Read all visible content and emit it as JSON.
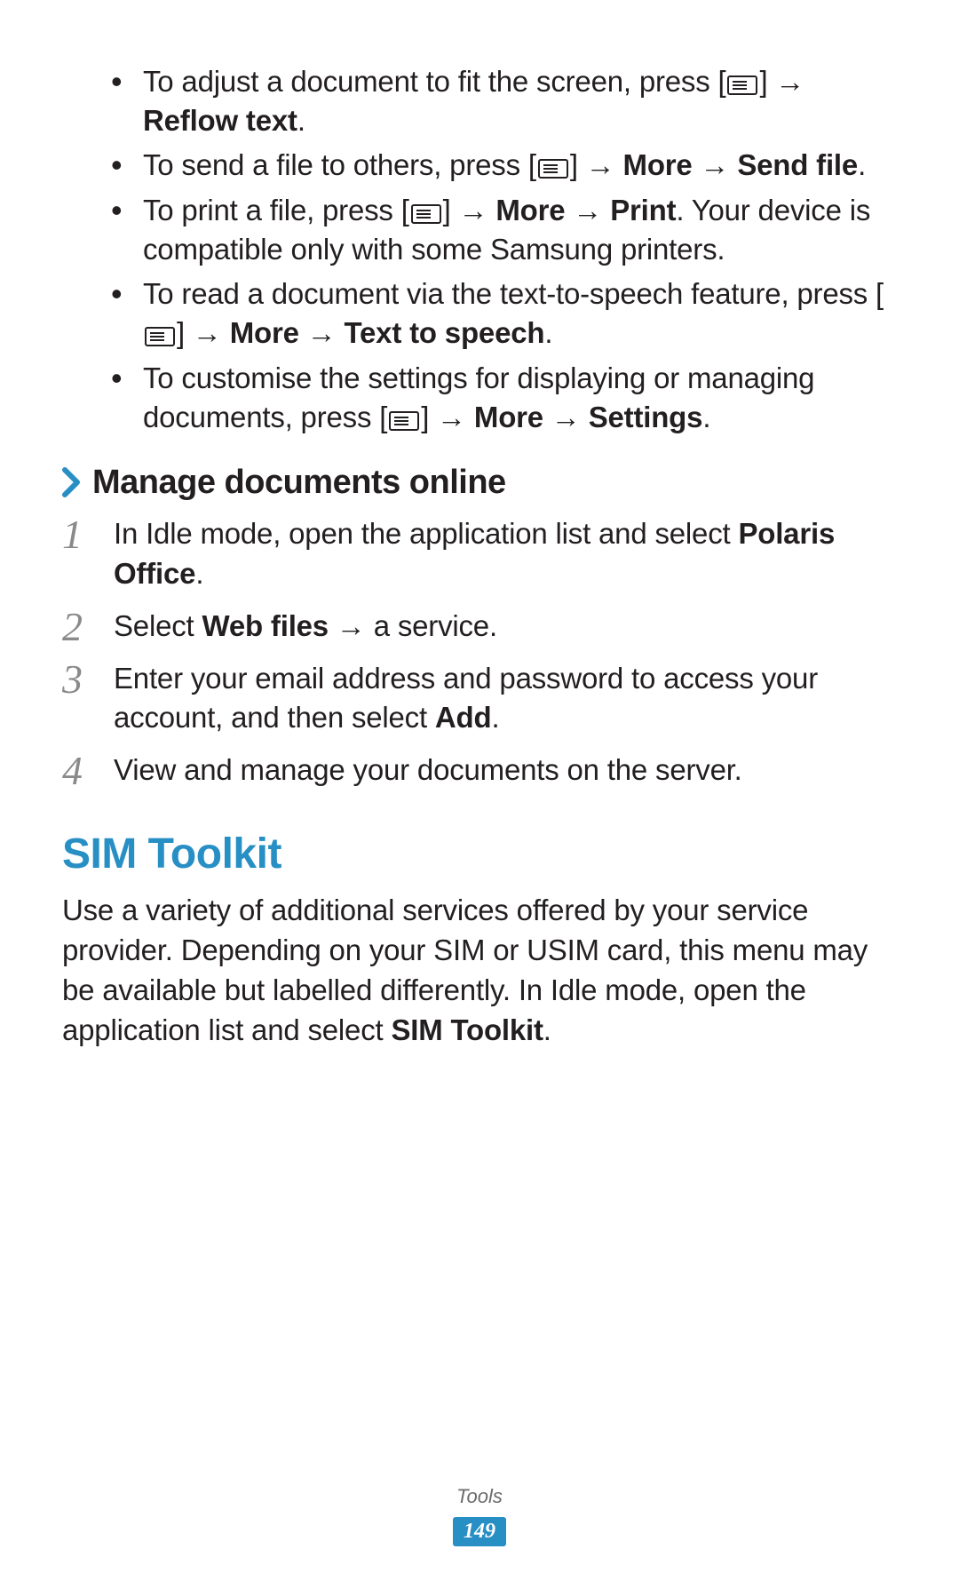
{
  "bullets": [
    {
      "parts": [
        {
          "t": "To adjust a document to fit the screen, press ["
        },
        {
          "icon": true
        },
        {
          "t": "] →"
        },
        {
          "break": true
        },
        {
          "t": "Reflow text",
          "b": true
        },
        {
          "t": "."
        }
      ]
    },
    {
      "parts": [
        {
          "t": "To send a file to others, press ["
        },
        {
          "icon": true
        },
        {
          "t": "] → "
        },
        {
          "t": "More",
          "b": true
        },
        {
          "t": " → "
        },
        {
          "t": "Send file",
          "b": true
        },
        {
          "t": "."
        }
      ]
    },
    {
      "parts": [
        {
          "t": "To print a file, press ["
        },
        {
          "icon": true
        },
        {
          "t": "] → "
        },
        {
          "t": "More",
          "b": true
        },
        {
          "t": " → "
        },
        {
          "t": "Print",
          "b": true
        },
        {
          "t": ". Your device is compatible only with some Samsung printers."
        }
      ]
    },
    {
      "parts": [
        {
          "t": "To read a document via the text-to-speech feature, press ["
        },
        {
          "icon": true
        },
        {
          "t": "] → "
        },
        {
          "t": "More",
          "b": true
        },
        {
          "t": " → "
        },
        {
          "t": "Text to speech",
          "b": true
        },
        {
          "t": "."
        }
      ]
    },
    {
      "parts": [
        {
          "t": "To customise the settings for displaying or managing documents, press ["
        },
        {
          "icon": true
        },
        {
          "t": "] → "
        },
        {
          "t": "More",
          "b": true
        },
        {
          "t": " → "
        },
        {
          "t": "Settings",
          "b": true
        },
        {
          "t": "."
        }
      ]
    }
  ],
  "subheading": "Manage documents online",
  "steps": [
    {
      "parts": [
        {
          "t": "In Idle mode, open the application list and select "
        },
        {
          "t": "Polaris Office",
          "b": true
        },
        {
          "t": "."
        }
      ]
    },
    {
      "parts": [
        {
          "t": "Select "
        },
        {
          "t": "Web files",
          "b": true
        },
        {
          "t": " → a service."
        }
      ]
    },
    {
      "parts": [
        {
          "t": "Enter your email address and password to access your account, and then select "
        },
        {
          "t": "Add",
          "b": true
        },
        {
          "t": "."
        }
      ]
    },
    {
      "parts": [
        {
          "t": "View and manage your documents on the server."
        }
      ]
    }
  ],
  "sectionHeading": "SIM Toolkit",
  "sectionBody": {
    "parts": [
      {
        "t": "Use a variety of additional services offered by your service provider. Depending on your SIM or USIM card, this menu may be available but labelled differently. In Idle mode, open the application list and select "
      },
      {
        "t": "SIM Toolkit",
        "b": true
      },
      {
        "t": "."
      }
    ]
  },
  "footer": {
    "category": "Tools",
    "page": "149"
  },
  "icons": {
    "menu": "menu-icon",
    "chevron": "chevron-right-icon"
  }
}
